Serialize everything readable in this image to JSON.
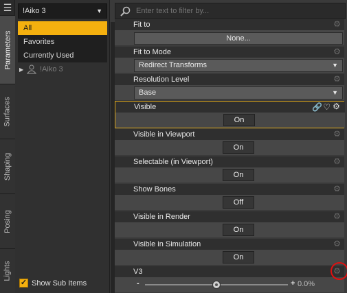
{
  "vtabs": {
    "menu_icon": "hamburger-icon",
    "items": [
      {
        "label": "Parameters",
        "active": true
      },
      {
        "label": "Surfaces",
        "active": false
      },
      {
        "label": "Shaping",
        "active": false
      },
      {
        "label": "Posing",
        "active": false
      },
      {
        "label": "Lights",
        "active": false
      }
    ]
  },
  "tree": {
    "figure_select": "!Aiko 3",
    "groups": [
      "All",
      "Favorites",
      "Currently Used"
    ],
    "node_label": "!Aiko 3",
    "show_sub_items_label": "Show Sub Items",
    "show_sub_items_checked": true
  },
  "search": {
    "placeholder": "Enter text to filter by..."
  },
  "properties": {
    "fit_to": {
      "label": "Fit to",
      "value": "None..."
    },
    "fit_to_mode": {
      "label": "Fit to Mode",
      "value": "Redirect Transforms"
    },
    "resolution_level": {
      "label": "Resolution Level",
      "value": "Base"
    },
    "visible": {
      "label": "Visible",
      "value": "On"
    },
    "visible_in_viewport": {
      "label": "Visible in Viewport",
      "value": "On"
    },
    "selectable": {
      "label": "Selectable (in Viewport)",
      "value": "On"
    },
    "show_bones": {
      "label": "Show Bones",
      "value": "Off"
    },
    "visible_in_render": {
      "label": "Visible in Render",
      "value": "On"
    },
    "visible_in_simulation": {
      "label": "Visible in Simulation",
      "value": "On"
    },
    "v3": {
      "label": "V3",
      "minus": "-",
      "plus": "+",
      "value": "0.0%",
      "fraction": 0.5
    }
  },
  "colors": {
    "accent": "#f4b00f",
    "highlight_border": "#d9a418",
    "annotation_circle": "#e01010"
  }
}
